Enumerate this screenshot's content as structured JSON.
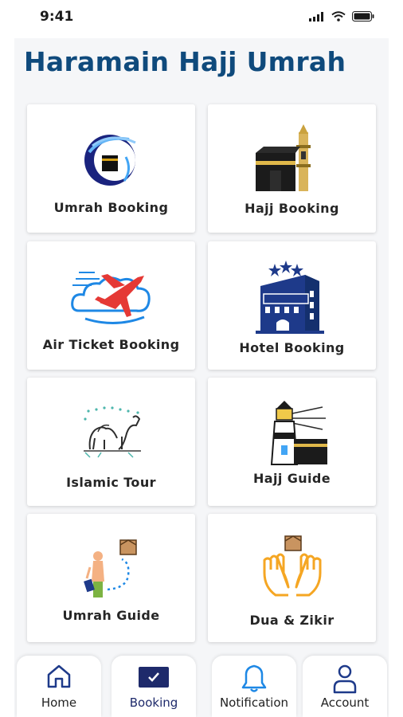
{
  "status_bar": {
    "time": "9:41"
  },
  "app": {
    "title": "Haramain Hajj Umrah"
  },
  "cards": [
    {
      "label": "Umrah Booking",
      "icon": "umrah-logo-icon"
    },
    {
      "label": "Hajj Booking",
      "icon": "kaaba-minaret-icon"
    },
    {
      "label": "Air Ticket Booking",
      "icon": "airplane-cloud-icon"
    },
    {
      "label": "Hotel Booking",
      "icon": "hotel-building-icon"
    },
    {
      "label": "Islamic Tour",
      "icon": "camel-icon"
    },
    {
      "label": "Hajj Guide",
      "icon": "lighthouse-kaaba-icon"
    },
    {
      "label": "Umrah Guide",
      "icon": "traveler-route-icon"
    },
    {
      "label": "Dua & Zikir",
      "icon": "praying-hands-icon"
    }
  ],
  "bottom_nav": [
    {
      "label": "Home",
      "icon": "home-icon"
    },
    {
      "label": "Booking",
      "icon": "booking-check-icon",
      "active": true
    },
    {
      "label": "Notification",
      "icon": "bell-icon"
    },
    {
      "label": "Account",
      "icon": "user-icon"
    }
  ],
  "colors": {
    "title": "#0f4a7c",
    "nav_active": "#1e2a6b",
    "nav_icon": "#1e3a8a"
  }
}
